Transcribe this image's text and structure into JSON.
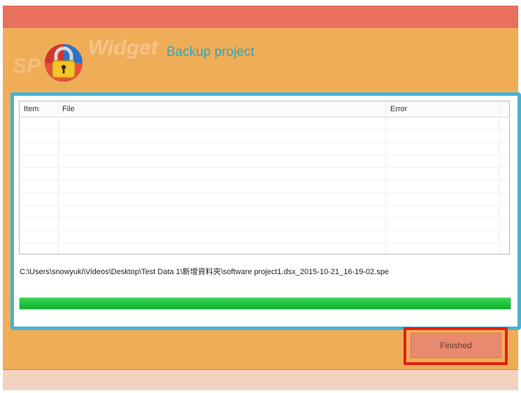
{
  "header": {
    "logo_prefix": "SP",
    "logo_suffix": "Widget",
    "title": "Backup project"
  },
  "table": {
    "columns": [
      "Item",
      "File",
      "Error"
    ],
    "rows": []
  },
  "status": {
    "current_path": "C:\\Users\\snowyuki\\Videos\\Desktop\\Test Data 1\\新增資料夾\\software project1.dsx_2015-10-21_16-19-02.spe"
  },
  "progress": {
    "value": 1.0
  },
  "footer": {
    "finished_label": "Finished"
  },
  "colors": {
    "title_bar": "#e7705f",
    "window_bg": "#f0ad58",
    "panel_border": "#43b3d6",
    "progress": "#1cc23c",
    "highlight": "#e41d17",
    "title_text": "#2aa7c0"
  },
  "icons": {
    "logo": "padlock-icon"
  }
}
